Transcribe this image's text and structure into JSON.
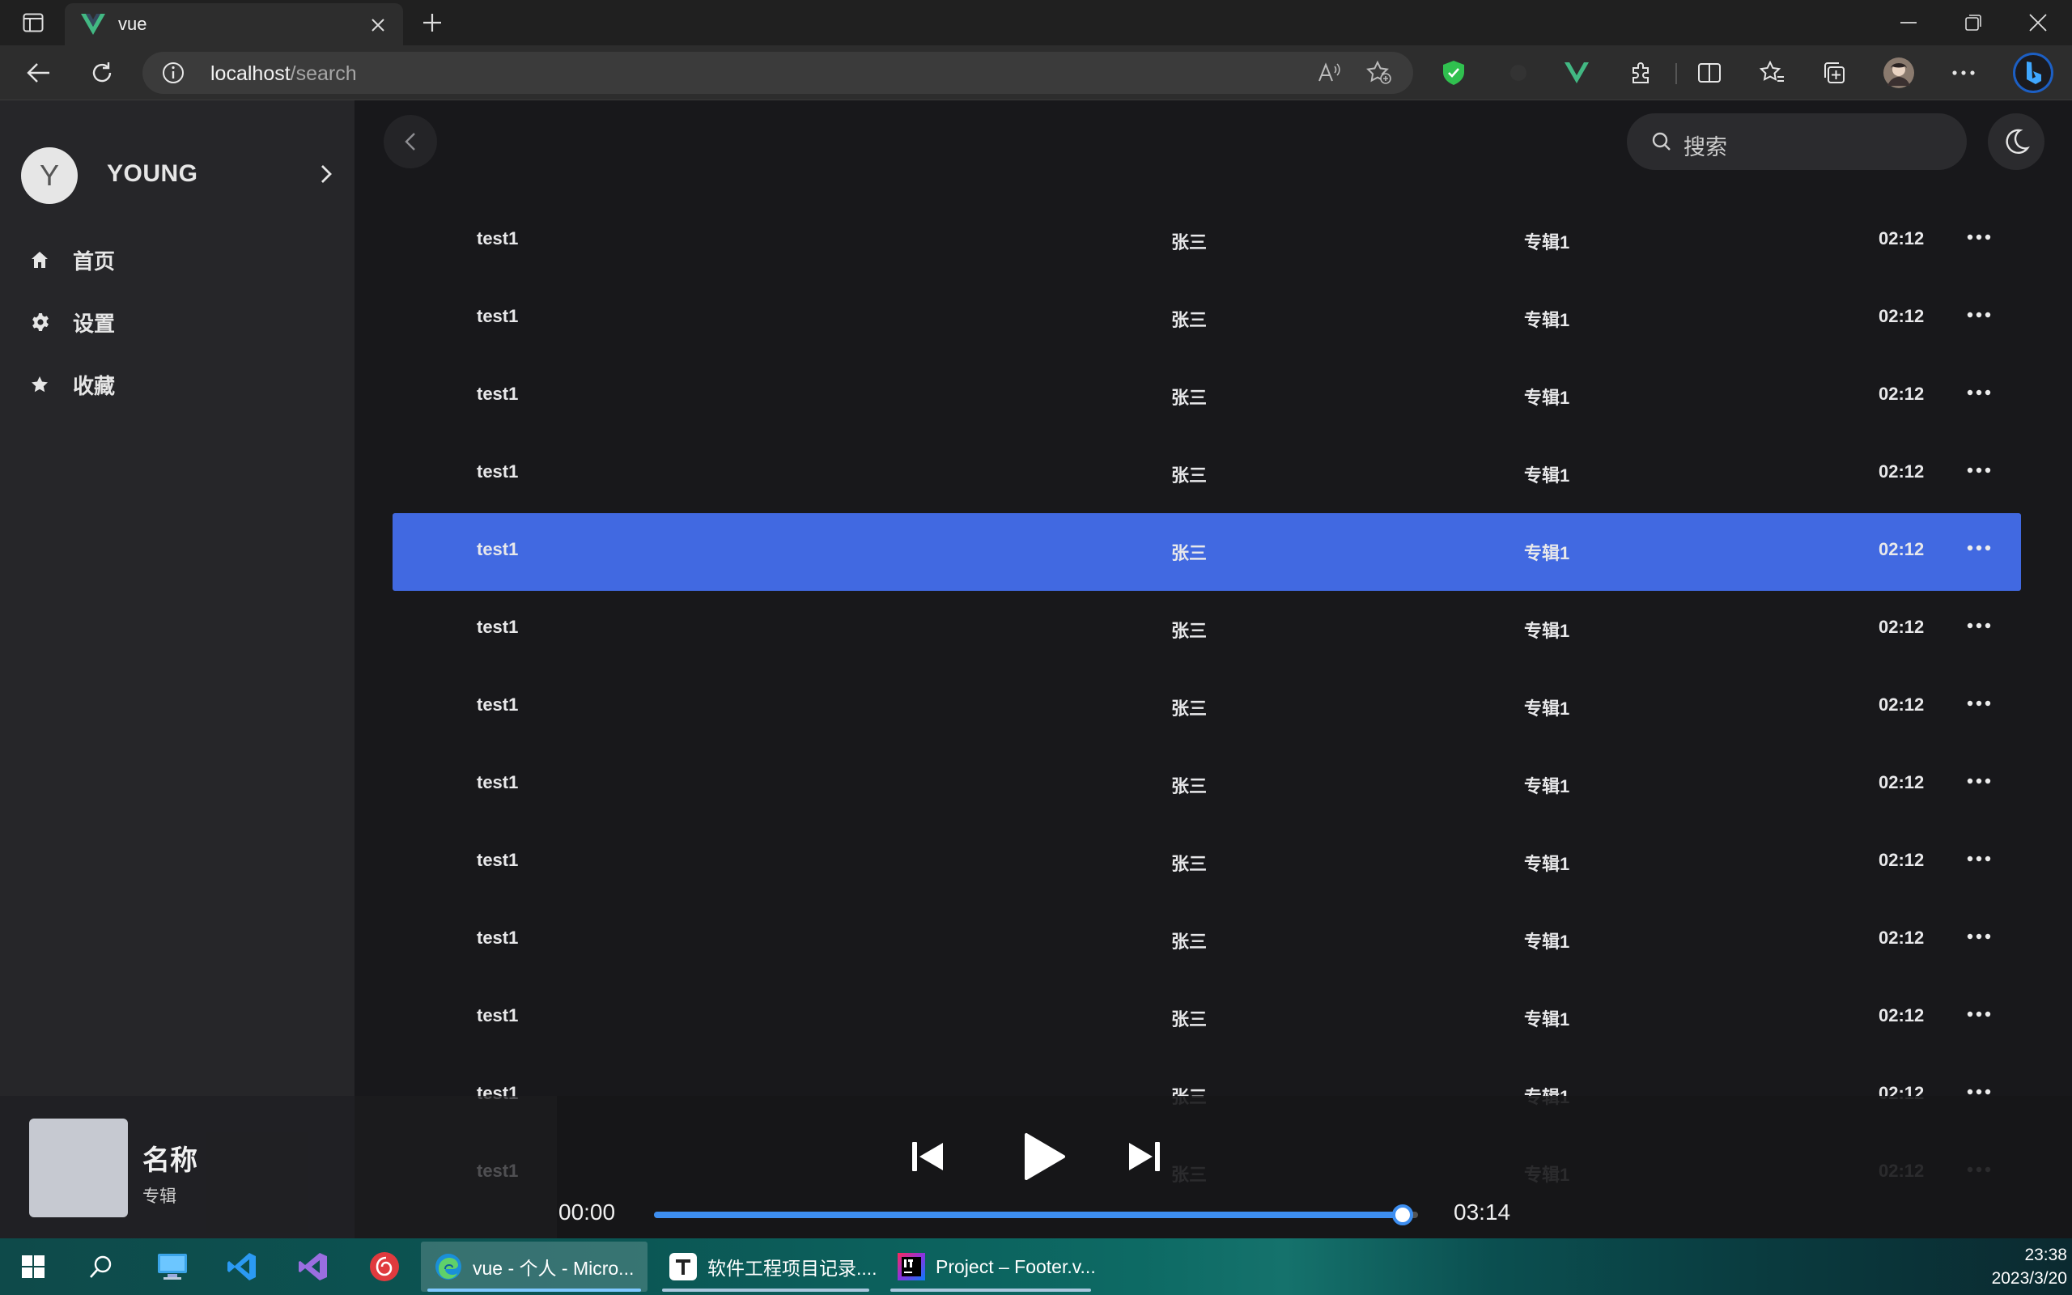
{
  "browser": {
    "tab_title": "vue",
    "url_host": "localhost",
    "url_path": "/search",
    "accent_vue": "#42b883",
    "shield_color": "#30c04f"
  },
  "sidebar": {
    "user": {
      "avatar_letter": "Y",
      "name": "YOUNG"
    },
    "items": [
      {
        "label": "首页",
        "icon": "home-icon"
      },
      {
        "label": "设置",
        "icon": "gear-icon"
      },
      {
        "label": "收藏",
        "icon": "star-icon"
      }
    ]
  },
  "header": {
    "search_placeholder": "搜索"
  },
  "songs": [
    {
      "name": "test1",
      "artist": "张三",
      "album": "专辑1",
      "duration": "02:12"
    },
    {
      "name": "test1",
      "artist": "张三",
      "album": "专辑1",
      "duration": "02:12"
    },
    {
      "name": "test1",
      "artist": "张三",
      "album": "专辑1",
      "duration": "02:12"
    },
    {
      "name": "test1",
      "artist": "张三",
      "album": "专辑1",
      "duration": "02:12"
    },
    {
      "name": "test1",
      "artist": "张三",
      "album": "专辑1",
      "duration": "02:12"
    },
    {
      "name": "test1",
      "artist": "张三",
      "album": "专辑1",
      "duration": "02:12"
    },
    {
      "name": "test1",
      "artist": "张三",
      "album": "专辑1",
      "duration": "02:12"
    },
    {
      "name": "test1",
      "artist": "张三",
      "album": "专辑1",
      "duration": "02:12"
    },
    {
      "name": "test1",
      "artist": "张三",
      "album": "专辑1",
      "duration": "02:12"
    },
    {
      "name": "test1",
      "artist": "张三",
      "album": "专辑1",
      "duration": "02:12"
    },
    {
      "name": "test1",
      "artist": "张三",
      "album": "专辑1",
      "duration": "02:12"
    },
    {
      "name": "test1",
      "artist": "张三",
      "album": "专辑1",
      "duration": "02:12"
    },
    {
      "name": "test1",
      "artist": "张三",
      "album": "专辑1",
      "duration": "02:12"
    }
  ],
  "selected_song_index": 4,
  "selection_color": "#4169e1",
  "player": {
    "title": "名称",
    "album": "专辑",
    "current_time": "00:00",
    "total_time": "03:14",
    "progress_fraction": 0.98,
    "progress_color": "#3d8ef0"
  },
  "taskbar": {
    "apps": [
      {
        "label": "vue - 个人 - Micro...",
        "icon": "edge-icon",
        "active": true
      },
      {
        "label": "软件工程项目记录....",
        "icon": "typora-icon",
        "active": false
      },
      {
        "label": "Project – Footer.v...",
        "icon": "intellij-icon",
        "active": false
      }
    ],
    "time": "23:38",
    "date": "2023/3/20"
  }
}
